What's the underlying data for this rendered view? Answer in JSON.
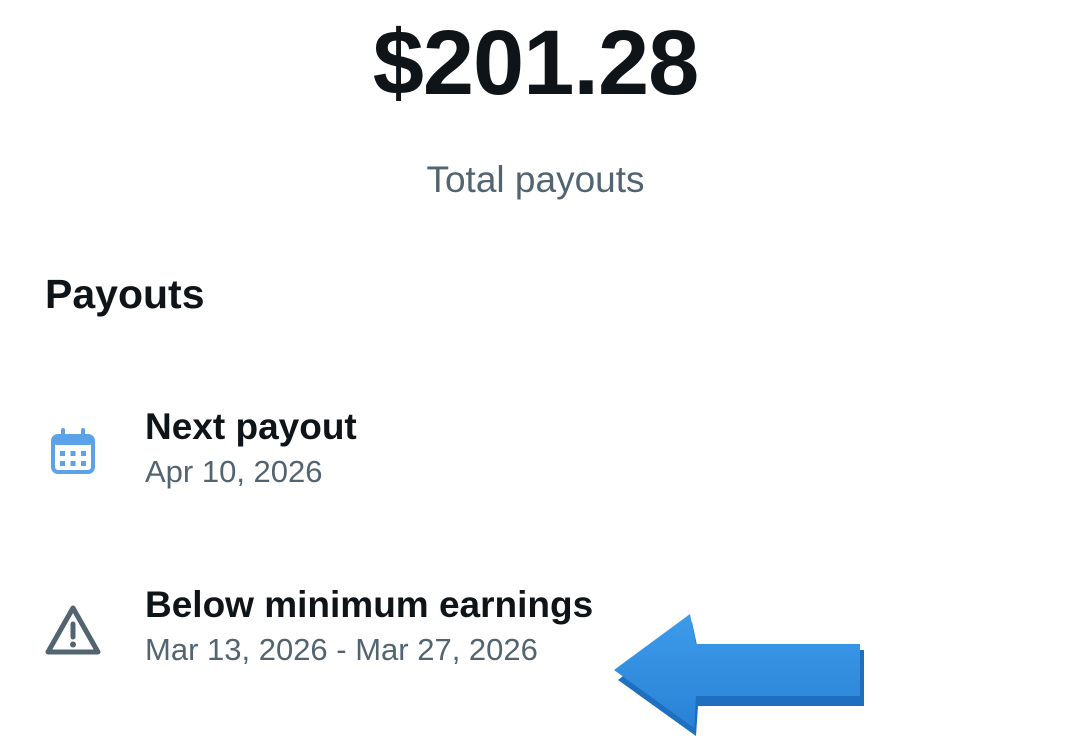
{
  "summary": {
    "total_amount": "$201.28",
    "total_label": "Total payouts"
  },
  "payouts": {
    "section_title": "Payouts",
    "items": [
      {
        "icon": "calendar-icon",
        "title": "Next payout",
        "subtitle": "Apr 10, 2026"
      },
      {
        "icon": "warning-icon",
        "title": "Below minimum earnings",
        "subtitle": "Mar 13, 2026 - Mar 27, 2026"
      }
    ]
  },
  "annotation": {
    "icon": "arrow-left-icon",
    "color": "#2f8fe0"
  },
  "colors": {
    "primary_text": "#0f1419",
    "secondary_text": "#536471",
    "calendar_icon": "#5ba2e8",
    "warning_icon": "#536471"
  }
}
